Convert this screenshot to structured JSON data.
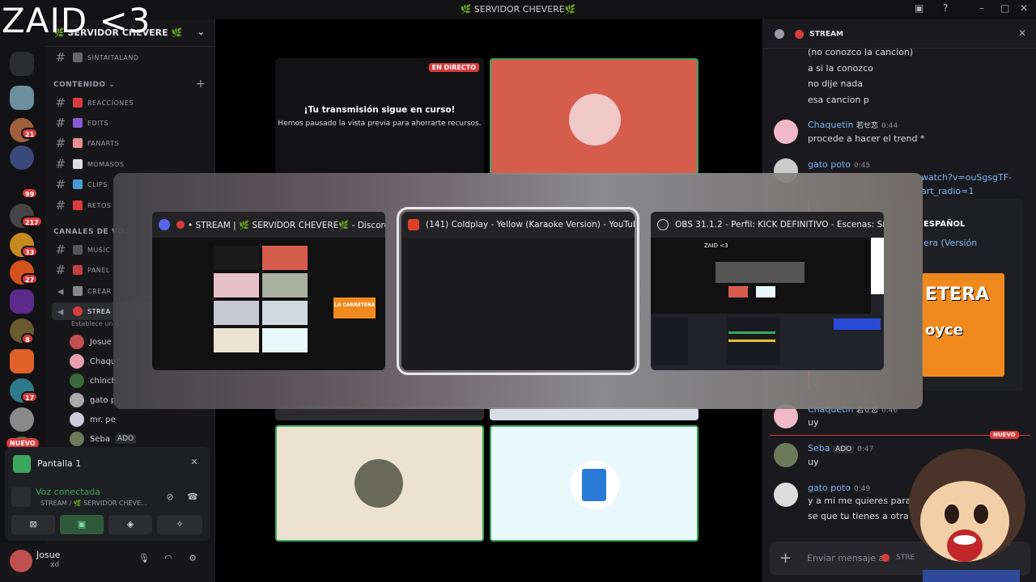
{
  "overlay_title": "ZAID <3",
  "titlebar": {
    "title": "🌿 SERVIDOR CHEVERE🌿"
  },
  "rail": {
    "badges": [
      "21",
      "99",
      "217",
      "33",
      "27",
      "8",
      "17"
    ],
    "new_label": "NUEVO"
  },
  "sidebar": {
    "server_name": "🌿 SERVIDOR CHEVERE 🌿",
    "top_channel": "SINTAITALAND",
    "category_content": "CONTENIDO",
    "channels": [
      "REACCIONES",
      "EDITS",
      "FANARTS",
      "MOMASOS",
      "CLIPS",
      "RETOS"
    ],
    "category_voice": "CANALES DE VO",
    "voice_channels": [
      "MUSIC",
      "PANEL",
      "CREAR",
      "STREA"
    ],
    "stream_status": "Establece un e",
    "voice_users": [
      {
        "name": "Josue",
        "tag": ""
      },
      {
        "name": "Chaqu",
        "tag": ""
      },
      {
        "name": "chinch",
        "tag": ""
      },
      {
        "name": "gato p",
        "tag": ""
      },
      {
        "name": "mr. pe",
        "tag": ""
      },
      {
        "name": "Seba",
        "tag": "ADO"
      }
    ]
  },
  "panel": {
    "screen_label": "Pantalla 1",
    "voice_status": "Voz conectada",
    "voice_channel": "STREAM / 🌿 SERVIDOR CHEVE...",
    "username": "Josue",
    "user_status": "xd"
  },
  "stage": {
    "live_badge": "EN DIRECTO",
    "paused_title": "¡Tu transmisión sigue en curso!",
    "paused_text": "Hemos pausado la vista previa para ahorrarte recursos."
  },
  "chat": {
    "header": "STREAM",
    "messages": [
      {
        "line": "(no conozco la cancion)"
      },
      {
        "line": "a si la conozco"
      },
      {
        "line": "no dije nada"
      },
      {
        "line": "esa cancion p"
      }
    ],
    "groups": [
      {
        "author": "Chaquetin",
        "tag": "若せ恋",
        "time": "0:44",
        "text": "procede a hacer el trend *"
      },
      {
        "author": "gato poto",
        "tag": "",
        "time": "0:45",
        "text": ""
      },
      {
        "author": "Chaquetin",
        "tag": "若せ恋",
        "time": "0:46",
        "text": "uy"
      },
      {
        "author": "Seba",
        "tag": "ADO",
        "time": "0:47",
        "text": "uy"
      },
      {
        "author": "gato poto",
        "tag": "",
        "time": "0:49",
        "text": "y a mi me quieres para",
        "text2": "se que tu tienes a otra"
      }
    ],
    "link_fragment_1": "watch?v=ouSgsgTF-",
    "link_fragment_2": "art_radio=1",
    "embed_label": "ESPAÑOL",
    "embed_title": "era (Versión",
    "embed_art_1": "ETERA",
    "embed_art_2": "oyce",
    "new_badge": "NUEVO",
    "composer_placeholder": "Enviar mensaje a",
    "composer_channel": "STRE"
  },
  "switcher": {
    "windows": [
      {
        "title": "• STREAM | 🌿 SERVIDOR CHEVERE🌿 - Discord",
        "selected": false
      },
      {
        "title": "(141) Coldplay - Yellow (Karaoke Version) - YouTube -...",
        "selected": true
      },
      {
        "title": "OBS 31.1.2 - Perfil: KICK DEFINITIVO - Escenas: Sin Títu...",
        "selected": false
      }
    ],
    "discord_thumb_banner": "LA CARRETERA",
    "obs_thumb_text": "ZAID <3"
  },
  "colors": {
    "accent_green": "#3ba55d",
    "mention_red": "#d83c3e",
    "link_blue": "#7bb1f5"
  }
}
